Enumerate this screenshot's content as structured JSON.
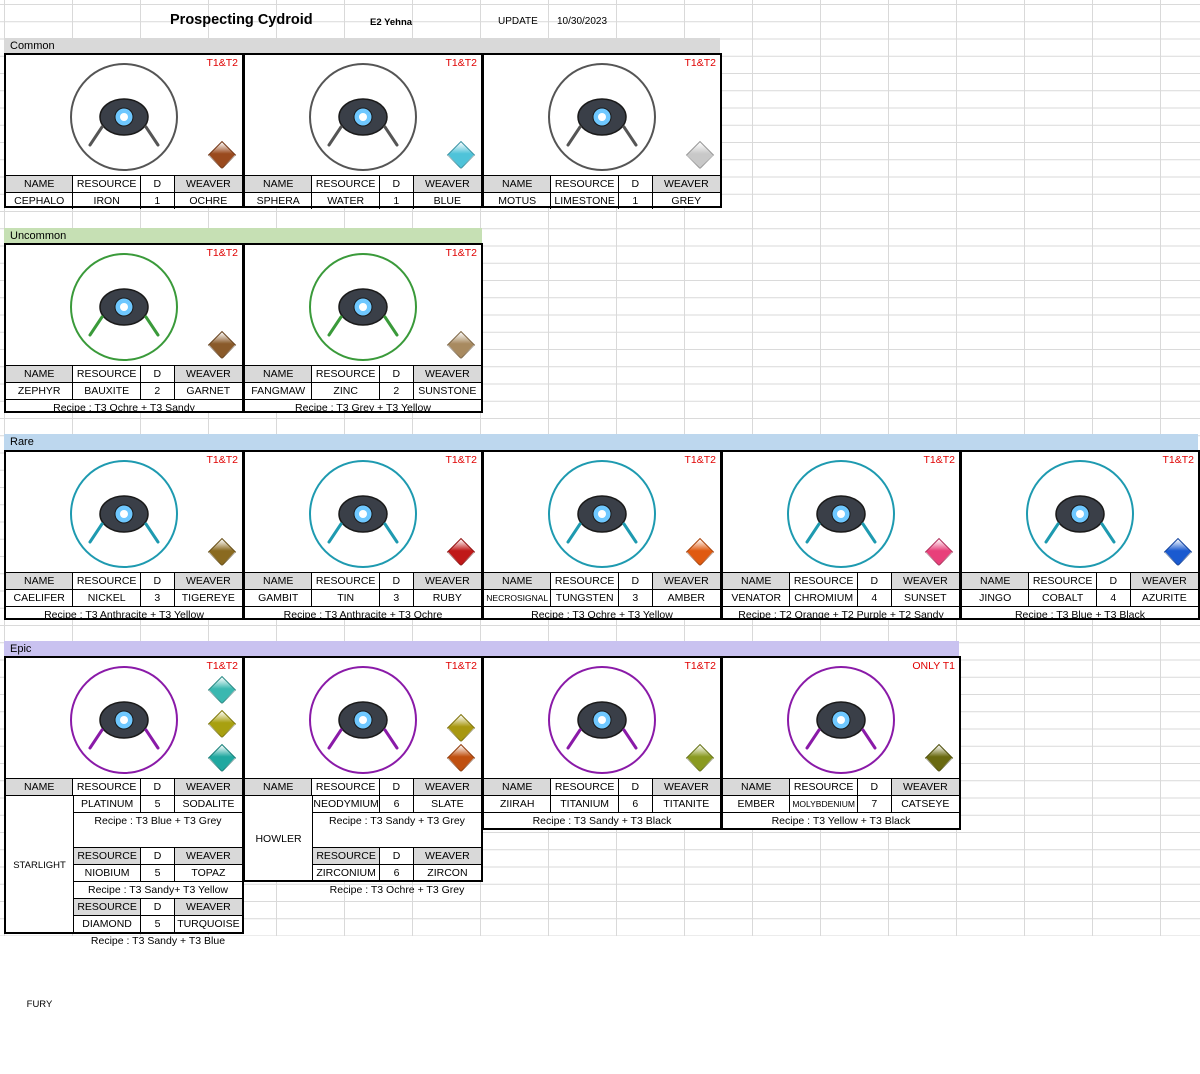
{
  "sheet": {
    "title": "Prospecting Cydroid",
    "author": "E2 Yehna",
    "update_label": "UPDATE",
    "update_date": "10/30/2023"
  },
  "labels": {
    "name": "NAME",
    "resource": "RESOURCE",
    "d": "D",
    "weaver": "WEAVER"
  },
  "sections": {
    "common": {
      "label": "Common",
      "color": "#d9d9d9"
    },
    "uncommon": {
      "label": "Uncommon",
      "color": "#c6e0b4"
    },
    "rare": {
      "label": "Rare",
      "color": "#bdd7ee"
    },
    "epic": {
      "label": "Epic",
      "color": "#c9c2f0"
    }
  },
  "common": [
    {
      "tier": "T1&T2",
      "name": "CEPHALO",
      "resource": "IRON",
      "d": "1",
      "weaver": "OCHRE",
      "ring": "#555555",
      "gem": "#9a4a1e"
    },
    {
      "tier": "T1&T2",
      "name": "SPHERA",
      "resource": "WATER",
      "d": "1",
      "weaver": "BLUE",
      "ring": "#555555",
      "gem": "#4fc3d9"
    },
    {
      "tier": "T1&T2",
      "name": "MOTUS",
      "resource": "LIMESTONE",
      "d": "1",
      "weaver": "GREY",
      "ring": "#555555",
      "gem": "#c8c8c8"
    }
  ],
  "uncommon": [
    {
      "tier": "T1&T2",
      "name": "ZEPHYR",
      "resource": "BAUXITE",
      "d": "2",
      "weaver": "GARNET",
      "ring": "#3a9a3a",
      "gem": "#8a5a2a",
      "recipe": "Recipe : T3 Ochre + T3 Sandy"
    },
    {
      "tier": "T1&T2",
      "name": "FANGMAW",
      "resource": "ZINC",
      "d": "2",
      "weaver": "SUNSTONE",
      "ring": "#3a9a3a",
      "gem": "#a88a60",
      "recipe": "Recipe : T3 Grey + T3 Yellow"
    }
  ],
  "rare": [
    {
      "tier": "T1&T2",
      "name": "CAELIFER",
      "resource": "NICKEL",
      "d": "3",
      "weaver": "TIGEREYE",
      "ring": "#1e9ab0",
      "gem": "#8a6a20",
      "recipe": "Recipe : T3 Anthracite + T3 Yellow"
    },
    {
      "tier": "T1&T2",
      "name": "GAMBIT",
      "resource": "TIN",
      "d": "3",
      "weaver": "RUBY",
      "ring": "#1e9ab0",
      "gem": "#c01818",
      "recipe": "Recipe : T3 Anthracite + T3 Ochre"
    },
    {
      "tier": "T1&T2",
      "name": "NECROSIGNAL",
      "resource": "TUNGSTEN",
      "d": "3",
      "weaver": "AMBER",
      "ring": "#1e9ab0",
      "gem": "#e05a10",
      "recipe": "Recipe : T3 Ochre + T3 Yellow"
    },
    {
      "tier": "T1&T2",
      "name": "VENATOR",
      "resource": "CHROMIUM",
      "d": "4",
      "weaver": "SUNSET",
      "ring": "#1e9ab0",
      "gem": "#e8407a",
      "recipe": "Recipe : T2 Orange + T2 Purple +  T2 Sandy"
    },
    {
      "tier": "T1&T2",
      "name": "JINGO",
      "resource": "COBALT",
      "d": "4",
      "weaver": "AZURITE",
      "ring": "#1e9ab0",
      "gem": "#1a5ad0",
      "recipe": "Recipe : T3 Blue + T3 Black"
    }
  ],
  "epic": {
    "cards": [
      {
        "tier": "T1&T2",
        "ring": "#8a1aa8",
        "gems": [
          "#3ab8b0",
          "#a8a010",
          "#20a8a0"
        ]
      },
      {
        "tier": "T1&T2",
        "ring": "#8a1aa8",
        "gems": [
          "#a89810",
          "#c05010"
        ]
      },
      {
        "tier": "T1&T2",
        "ring": "#8a1aa8",
        "gems": [
          "#8a9a20"
        ]
      },
      {
        "tier": "ONLY T1",
        "ring": "#8a1aa8",
        "gems": [
          "#6a6a10"
        ]
      }
    ],
    "starlight": {
      "name": "STARLIGHT FURY",
      "rows": [
        {
          "resource": "PLATINUM",
          "d": "5",
          "weaver": "SODALITE",
          "recipe": "Recipe : T3 Blue + T3 Grey"
        },
        {
          "resource": "NIOBIUM",
          "d": "5",
          "weaver": "TOPAZ",
          "recipe": "Recipe : T3 Sandy+ T3 Yellow"
        },
        {
          "resource": "DIAMOND",
          "d": "5",
          "weaver": "TURQUOISE",
          "recipe": "Recipe : T3 Sandy + T3 Blue"
        }
      ]
    },
    "howler": {
      "name": "HOWLER",
      "rows": [
        {
          "resource": "NEODYMIUM",
          "d": "6",
          "weaver": "SLATE",
          "recipe": "Recipe : T3 Sandy + T3 Grey"
        },
        {
          "resource": "ZIRCONIUM",
          "d": "6",
          "weaver": "ZIRCON",
          "recipe": "Recipe : T3 Ochre + T3 Grey"
        }
      ]
    },
    "ziirah": {
      "name": "ZIIRAH",
      "resource": "TITANIUM",
      "d": "6",
      "weaver": "TITANITE",
      "recipe": "Recipe : T3 Sandy + T3 Black"
    },
    "ember": {
      "name": "EMBER",
      "resource": "MOLYBDENIUM",
      "d": "7",
      "weaver": "CATSEYE",
      "recipe": "Recipe : T3 Yellow + T3 Black"
    }
  }
}
